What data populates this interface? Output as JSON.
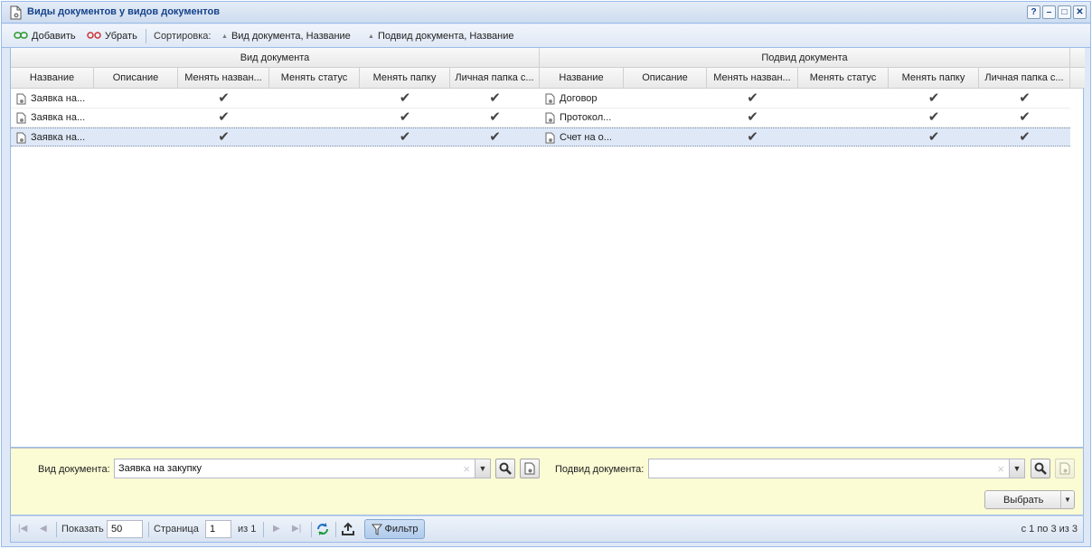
{
  "window": {
    "title": "Виды документов у видов документов",
    "tools": [
      "?",
      "–",
      "□",
      "✕"
    ]
  },
  "toolbar": {
    "add_label": "Добавить",
    "remove_label": "Убрать",
    "sort_label": "Сортировка:",
    "sort1_label": "Вид документа, Название",
    "sort2_label": "Подвид документа, Название"
  },
  "grid": {
    "group_left": "Вид документа",
    "group_right": "Подвид документа",
    "columns_left": [
      "Название",
      "Описание",
      "Менять назван...",
      "Менять статус",
      "Менять папку",
      "Личная папка с..."
    ],
    "columns_right": [
      "Название",
      "Описание",
      "Менять назван...",
      "Менять статус",
      "Менять папку",
      "Личная папка с..."
    ],
    "rows": [
      {
        "left_name": "Заявка на...",
        "right_name": "Договор",
        "check": "✔"
      },
      {
        "left_name": "Заявка на...",
        "right_name": "Протокол...",
        "check": "✔"
      },
      {
        "left_name": "Заявка на...",
        "right_name": "Счет на о...",
        "check": "✔"
      }
    ]
  },
  "filter": {
    "doc_type_label": "Вид документа:",
    "doc_type_value": "Заявка на закупку",
    "subtype_label": "Подвид документа:",
    "subtype_value": "",
    "clear_glyph": "×",
    "trigger_glyph": "▼",
    "choose_label": "Выбрать"
  },
  "pager": {
    "show_label": "Показать",
    "page_size": "50",
    "page_label": "Страница",
    "page_value": "1",
    "of_label": "из 1",
    "filter_label": "Фильтр",
    "info": "с 1 по 3 из 3"
  },
  "colors": {
    "header_blue": "#15428b",
    "panel_bg": "#dfe8f6",
    "filter_bg": "#fbfbd4",
    "border": "#99bbe8"
  }
}
